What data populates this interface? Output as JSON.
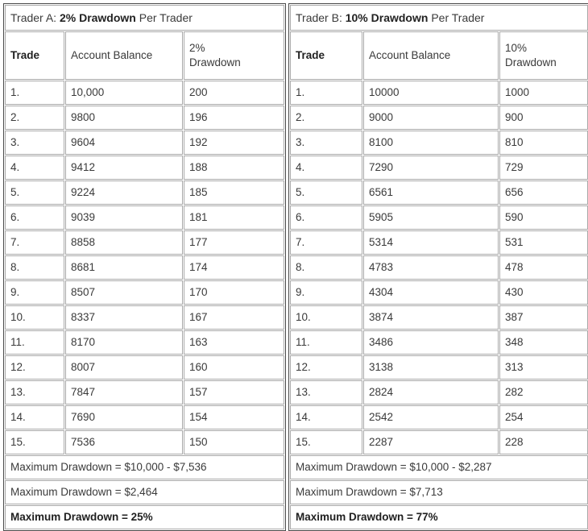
{
  "tables": [
    {
      "id": "trader-a",
      "title": {
        "prefix": "Trader A: ",
        "accent": "2% Drawdown",
        "suffix": " Per Trader"
      },
      "columns": [
        "Trade",
        "Account Balance",
        "2%\nDrawdown"
      ],
      "column_labels": {
        "trade": "Trade",
        "balance": "Account Balance",
        "drawdown_line1": "2%",
        "drawdown_line2": "Drawdown"
      },
      "rows": [
        {
          "trade": "1.",
          "balance": "10,000",
          "drawdown": "200"
        },
        {
          "trade": "2.",
          "balance": "9800",
          "drawdown": "196"
        },
        {
          "trade": "3.",
          "balance": "9604",
          "drawdown": "192"
        },
        {
          "trade": "4.",
          "balance": "9412",
          "drawdown": "188"
        },
        {
          "trade": "5.",
          "balance": "9224",
          "drawdown": "185"
        },
        {
          "trade": "6.",
          "balance": "9039",
          "drawdown": "181"
        },
        {
          "trade": "7.",
          "balance": "8858",
          "drawdown": "177"
        },
        {
          "trade": "8.",
          "balance": "8681",
          "drawdown": "174"
        },
        {
          "trade": "9.",
          "balance": "8507",
          "drawdown": "170"
        },
        {
          "trade": "10.",
          "balance": "8337",
          "drawdown": "167"
        },
        {
          "trade": "11.",
          "balance": "8170",
          "drawdown": "163"
        },
        {
          "trade": "12.",
          "balance": "8007",
          "drawdown": "160"
        },
        {
          "trade": "13.",
          "balance": "7847",
          "drawdown": "157"
        },
        {
          "trade": "14.",
          "balance": "7690",
          "drawdown": "154"
        },
        {
          "trade": "15.",
          "balance": "7536",
          "drawdown": "150"
        }
      ],
      "summary": [
        "Maximum Drawdown = $10,000 - $7,536",
        "Maximum Drawdown = $2,464",
        "Maximum Drawdown = 25%"
      ]
    },
    {
      "id": "trader-b",
      "title": {
        "prefix": "Trader B: ",
        "accent": "10% Drawdown",
        "suffix": " Per Trader"
      },
      "columns": [
        "Trade",
        "Account Balance",
        "10%\nDrawdown"
      ],
      "column_labels": {
        "trade": "Trade",
        "balance": "Account Balance",
        "drawdown_line1": "10%",
        "drawdown_line2": "Drawdown"
      },
      "rows": [
        {
          "trade": "1.",
          "balance": "10000",
          "drawdown": "1000"
        },
        {
          "trade": "2.",
          "balance": "9000",
          "drawdown": "900"
        },
        {
          "trade": "3.",
          "balance": "8100",
          "drawdown": "810"
        },
        {
          "trade": "4.",
          "balance": "7290",
          "drawdown": "729"
        },
        {
          "trade": "5.",
          "balance": "6561",
          "drawdown": "656"
        },
        {
          "trade": "6.",
          "balance": "5905",
          "drawdown": "590"
        },
        {
          "trade": "7.",
          "balance": "5314",
          "drawdown": "531"
        },
        {
          "trade": "8.",
          "balance": "4783",
          "drawdown": "478"
        },
        {
          "trade": "9.",
          "balance": "4304",
          "drawdown": "430"
        },
        {
          "trade": "10.",
          "balance": "3874",
          "drawdown": "387"
        },
        {
          "trade": "11.",
          "balance": "3486",
          "drawdown": "348"
        },
        {
          "trade": "12.",
          "balance": "3138",
          "drawdown": "313"
        },
        {
          "trade": "13.",
          "balance": "2824",
          "drawdown": "282"
        },
        {
          "trade": "14.",
          "balance": "2542",
          "drawdown": "254"
        },
        {
          "trade": "15.",
          "balance": "2287",
          "drawdown": "228"
        }
      ],
      "summary": [
        "Maximum Drawdown = $10,000 - $2,287",
        "Maximum Drawdown = $7,713",
        "Maximum Drawdown = 77%"
      ]
    }
  ],
  "colors": {
    "text": "#3a3a3a",
    "strong_text": "#1f1f1f",
    "outer_border": "#4a4a4a",
    "cell_border": "#a9a9a9",
    "background": "#ffffff"
  }
}
